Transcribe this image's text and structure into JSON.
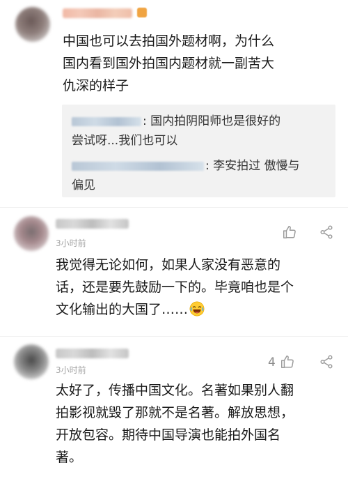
{
  "comments": [
    {
      "text": "中国也可以去拍国外题材啊，为什么\n国内看到国外拍国内题材就一副苦大\n仇深的样子",
      "replies": [
        {
          "text": ": 国内拍阴阳师也是很好的\n尝试呀...我们也可以"
        },
        {
          "text": ": 李安拍过 傲慢与\n偏见"
        }
      ]
    },
    {
      "time": "3小时前",
      "text": "我觉得无论如何，如果人家没有恶意的\n话，还是要先鼓励一下的。毕竟咱也是个\n文化输出的大国了……",
      "like_count": ""
    },
    {
      "time": "3小时前",
      "text": "太好了，传播中国文化。名著如果别人翻\n拍影视就毁了那就不是名著。解放思想，\n开放包容。期待中国导演也能拍外国名\n著。",
      "like_count": "4"
    }
  ],
  "icons": {
    "like": "thumbs-up-icon",
    "share": "share-icon",
    "emoji": "laughing-crying-emoji-icon"
  },
  "colors": {
    "text": "#1a1a1a",
    "meta": "#a3a3a3",
    "quote_bg": "#f2f2f2",
    "icon": "#9a9a9a"
  }
}
